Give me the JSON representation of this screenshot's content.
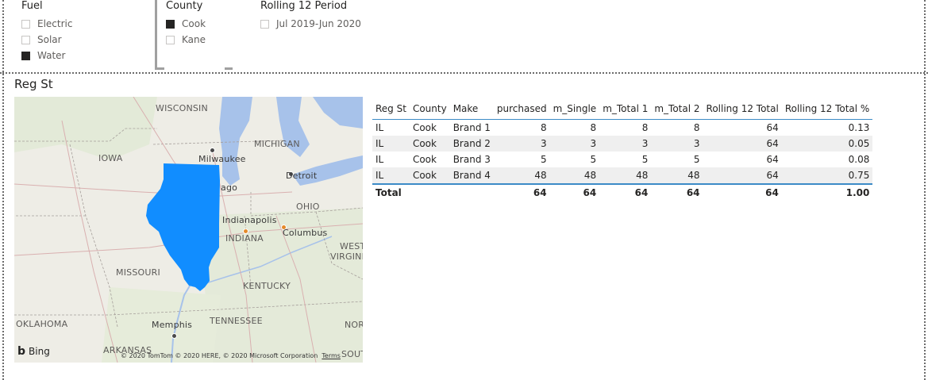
{
  "slicers": {
    "fuel": {
      "title": "Fuel",
      "items": [
        {
          "label": "Electric",
          "checked": false
        },
        {
          "label": "Solar",
          "checked": false
        },
        {
          "label": "Water",
          "checked": true
        }
      ]
    },
    "county": {
      "title": "County",
      "items": [
        {
          "label": "Cook",
          "checked": true
        },
        {
          "label": "Kane",
          "checked": false
        }
      ]
    },
    "rolling": {
      "title": "Rolling 12 Period",
      "items": [
        {
          "label": "Jul 2019-Jun 2020",
          "checked": false
        }
      ]
    }
  },
  "map": {
    "title": "Reg St",
    "labels": {
      "wisconsin": "WISCONSIN",
      "michigan": "MICHIGAN",
      "iowa": "IOWA",
      "ohio": "OHIO",
      "indiana": "INDIANA",
      "missouri": "MISSOURI",
      "kentucky": "KENTUCKY",
      "tennessee": "TENNESSEE",
      "oklahoma": "OKLAHOMA",
      "arkansas": "ARKANSAS",
      "west_virginia_1": "WEST",
      "west_virginia_2": "VIRGINI",
      "north_carolina": "NOR",
      "south": "SOUTH",
      "milwaukee": "Milwaukee",
      "detroit": "Detroit",
      "chicago": "ago",
      "indianapolis": "Indianapolis",
      "columbus": "Columbus",
      "memphis": "Memphis"
    },
    "bing_label": "Bing",
    "copyright": "© 2020 TomTom © 2020 HERE, © 2020 Microsoft Corporation",
    "terms": "Terms",
    "highlight_color": "#118dff"
  },
  "table": {
    "headers": [
      "Reg St",
      "County",
      "Make",
      "purchased",
      "m_Single",
      "m_Total 1",
      "m_Total 2",
      "Rolling 12 Total",
      "Rolling 12 Total %"
    ],
    "rows": [
      [
        "IL",
        "Cook",
        "Brand 1",
        "8",
        "8",
        "8",
        "8",
        "64",
        "0.13"
      ],
      [
        "IL",
        "Cook",
        "Brand 2",
        "3",
        "3",
        "3",
        "3",
        "64",
        "0.05"
      ],
      [
        "IL",
        "Cook",
        "Brand 3",
        "5",
        "5",
        "5",
        "5",
        "64",
        "0.08"
      ],
      [
        "IL",
        "Cook",
        "Brand 4",
        "48",
        "48",
        "48",
        "48",
        "64",
        "0.75"
      ]
    ],
    "total": [
      "Total",
      "",
      "",
      "64",
      "64",
      "64",
      "64",
      "64",
      "1.00"
    ]
  }
}
